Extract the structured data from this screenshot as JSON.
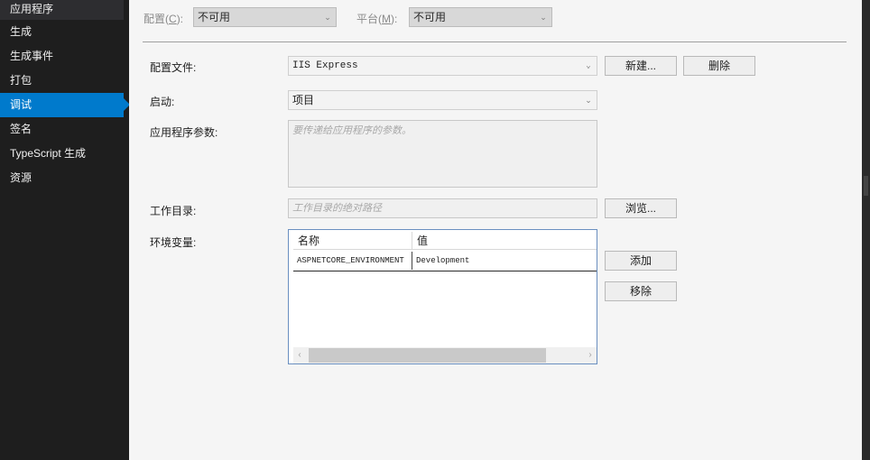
{
  "sidebar": {
    "items": [
      {
        "label": "应用程序"
      },
      {
        "label": "生成"
      },
      {
        "label": "生成事件"
      },
      {
        "label": "打包"
      },
      {
        "label": "调试"
      },
      {
        "label": "签名"
      },
      {
        "label": "TypeScript 生成"
      },
      {
        "label": "资源"
      }
    ],
    "active_index": 4
  },
  "top_bar": {
    "config_label": "配置",
    "config_accel": "C",
    "config_value": "不可用",
    "platform_label": "平台",
    "platform_accel": "M",
    "platform_value": "不可用"
  },
  "form": {
    "profile_label": "配置文件:",
    "profile_value": "IIS Express",
    "new_button": "新建...",
    "delete_button": "删除",
    "launch_label": "启动:",
    "launch_value": "项目",
    "app_args_label": "应用程序参数:",
    "app_args_placeholder": "要传递给应用程序的参数。",
    "workdir_label": "工作目录:",
    "workdir_placeholder": "工作目录的绝对路径",
    "browse_button": "浏览...",
    "env_label": "环境变量:",
    "env_table": {
      "columns": [
        "名称",
        "值"
      ],
      "rows": [
        {
          "name": "ASPNETCORE_ENVIRONMENT",
          "value": "Development"
        }
      ]
    },
    "add_button": "添加",
    "remove_button": "移除"
  },
  "colors": {
    "accent": "#007acc",
    "sidebar_bg": "#1e1e1e",
    "panel_bg": "#f5f5f5"
  }
}
